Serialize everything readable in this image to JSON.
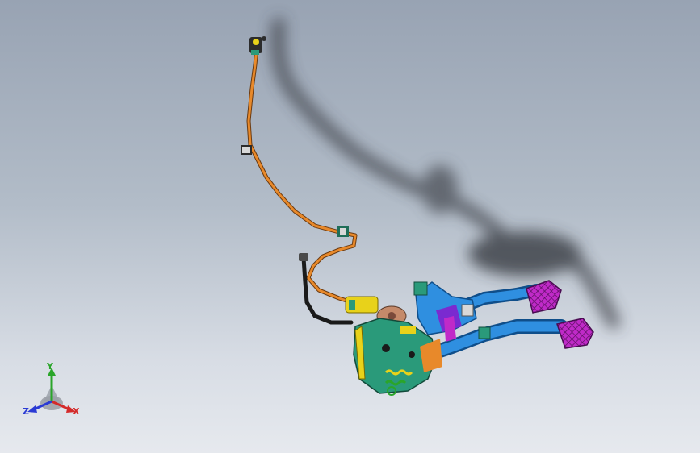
{
  "viewport": {
    "background_top": "#98a3b3",
    "background_bottom": "#e6e9ee"
  },
  "model": {
    "cable_color": "#e8892a",
    "pedal_arm_color": "#2f8fe0",
    "pedal_pad_color": "#c02ac8",
    "bracket_color": "#2a9a7a",
    "sensor_color": "#e8d21a",
    "shadow_color": "#3a3e44"
  },
  "triad": {
    "x_label": "X",
    "y_label": "Y",
    "z_label": "Z",
    "x_color": "#d42a2a",
    "y_color": "#2aa52a",
    "z_color": "#2a3ad4"
  }
}
